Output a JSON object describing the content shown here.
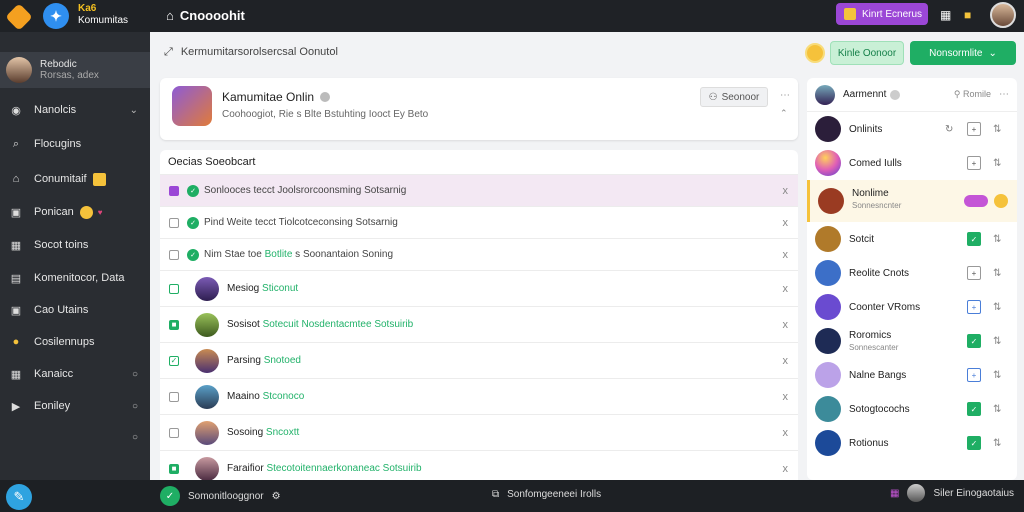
{
  "app": {
    "brand_line1": "Ka6",
    "brand_line2": "Komumitas",
    "title": "Cnoooohit"
  },
  "topbar": {
    "premium_label": "Kinrt Ecnerus",
    "colors": {
      "bar": "#1f2226",
      "premium": "#9b47d6"
    }
  },
  "sidebar": {
    "user": {
      "name_line1": "Rebodic",
      "name_line2": "Rorsas, adex"
    },
    "items": [
      {
        "label": "Nanolcis",
        "icon": "compass-icon",
        "chevron": "v"
      },
      {
        "label": "Flocugins",
        "icon": "search-icon"
      },
      {
        "label": "Conumitaif",
        "icon": "home-icon",
        "badge": "emoji"
      },
      {
        "label": "Ponican",
        "icon": "chat-icon",
        "badge": "emoji"
      },
      {
        "label": "Socot toins",
        "icon": "calendar-icon"
      },
      {
        "label": "Komenitocor, Data",
        "icon": "grid-icon"
      },
      {
        "label": "Cao Utains",
        "icon": "chat-icon"
      },
      {
        "label": "Cosilennups",
        "icon": "emoji-icon"
      },
      {
        "label": "Kanaicc",
        "icon": "people-icon",
        "chevron": "o"
      },
      {
        "label": "Eoniley",
        "icon": "bookmark-icon",
        "chevron": "o"
      }
    ]
  },
  "main": {
    "breadcrumb": "Kermumitarsorolsercsal Oonutol",
    "btn_light": "Kinle Oonoor",
    "btn_green": "Nonsormlite",
    "header": {
      "title": "Kamumitae Onlin",
      "subtitle": "Coohoogiot, Rie s Blte Bstuhting Iooct Ey Beto",
      "search_btn": "Seonoor"
    },
    "list_title": "Oecias Soeobcart",
    "rows": [
      {
        "text": "Sonlooces tecct Joolsrorcoonsming Sotsarnig",
        "x": "x"
      },
      {
        "text": "Pind Weite tecct Tiolcotceconsing Sotsarnig",
        "x": "x"
      },
      {
        "text_a": "Nim Stae toe",
        "text_b": "Botlite",
        "text_c": "s Soonantaion Soning",
        "x": "x"
      },
      {
        "name": "Mesiog",
        "tag": "Sticonut",
        "x": "x"
      },
      {
        "name": "Sosisot",
        "tag": "Sotecuit Nosdentacmtee",
        "tag2": "Sotsuirib",
        "x": "x"
      },
      {
        "name": "Parsing",
        "tag": "Snotoed",
        "x": "x"
      },
      {
        "name": "Maaino",
        "tag": "Stconoco",
        "x": "x"
      },
      {
        "name": "Sosoing",
        "tag": "Sncoxtt",
        "x": "x"
      },
      {
        "name": "Faraifior",
        "tag": "Stecotoitennaerkonaneac",
        "tag2": "Sotsuirib",
        "x": "x"
      }
    ]
  },
  "right_panel": {
    "header": {
      "title": "Aarmennt",
      "right": "Romile"
    },
    "people": [
      {
        "name": "Onlinits",
        "avatar": "#2b1e3a"
      },
      {
        "name": "Comed Iulls",
        "avatar": "#e05fb6"
      },
      {
        "name": "Nonlime",
        "sub": "Sonnesncnter",
        "avatar": "#9a3b22"
      },
      {
        "name": "Sotcit",
        "avatar": "#b07a2a"
      },
      {
        "name": "Reolite Cnots",
        "avatar": "#3c6fc8"
      },
      {
        "name": "Coonter VRoms",
        "avatar": "#6a4bd0"
      },
      {
        "name": "Roromics",
        "sub": "Sonnescanter",
        "avatar": "#1e2b55"
      },
      {
        "name": "Nalne Bangs",
        "avatar": "#bba2e8"
      },
      {
        "name": "Sotogtocochs",
        "avatar": "#3c8b9a"
      },
      {
        "name": "Rotionus",
        "avatar": "#1c4a99"
      }
    ]
  },
  "bottombar": {
    "left": "Somonitlooggnor",
    "mid": "Sonfomgeeneei Irolls",
    "right": "Siler Einogaotaius"
  }
}
